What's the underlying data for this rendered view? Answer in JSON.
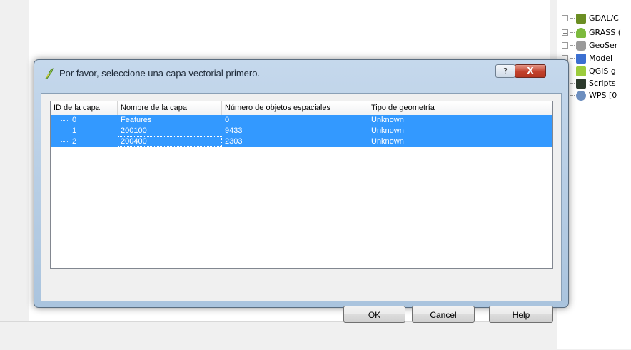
{
  "dialog": {
    "title": "Por favor, seleccione una capa vectorial primero.",
    "help_glyph": "?",
    "close_glyph": "X",
    "columns": [
      "ID de la capa",
      "Nombre de la capa",
      "Número de objetos espaciales",
      "Tipo de geometría"
    ],
    "rows": [
      {
        "id": "0",
        "name": "Features",
        "count": "0",
        "geometry": "Unknown"
      },
      {
        "id": "1",
        "name": "200100",
        "count": "9433",
        "geometry": "Unknown"
      },
      {
        "id": "2",
        "name": "200400",
        "count": "2303",
        "geometry": "Unknown"
      }
    ],
    "buttons": {
      "ok": "OK",
      "cancel": "Cancel",
      "help": "Help"
    }
  },
  "toolbox": {
    "items": [
      {
        "label": "GDAL/C",
        "icon": "gdal-icon",
        "color": "#6b8e23"
      },
      {
        "label": "GRASS (",
        "icon": "grass-icon",
        "color": "#7cba3d"
      },
      {
        "label": "GeoSer",
        "icon": "database-icon",
        "color": "#8a8a8a"
      },
      {
        "label": "Model",
        "icon": "model-icon",
        "color": "#3b6fd1"
      },
      {
        "label": "QGIS g",
        "icon": "qgis-icon",
        "color": "#9ccc3c"
      },
      {
        "label": "Scripts",
        "icon": "script-icon",
        "color": "#2c3a2c"
      },
      {
        "label": "WPS [0",
        "icon": "wps-icon",
        "color": "#6c8ebf"
      }
    ]
  },
  "colors": {
    "selection": "#3399ff",
    "dialog_frame": "#aac4de",
    "close_button": "#c2412c"
  }
}
